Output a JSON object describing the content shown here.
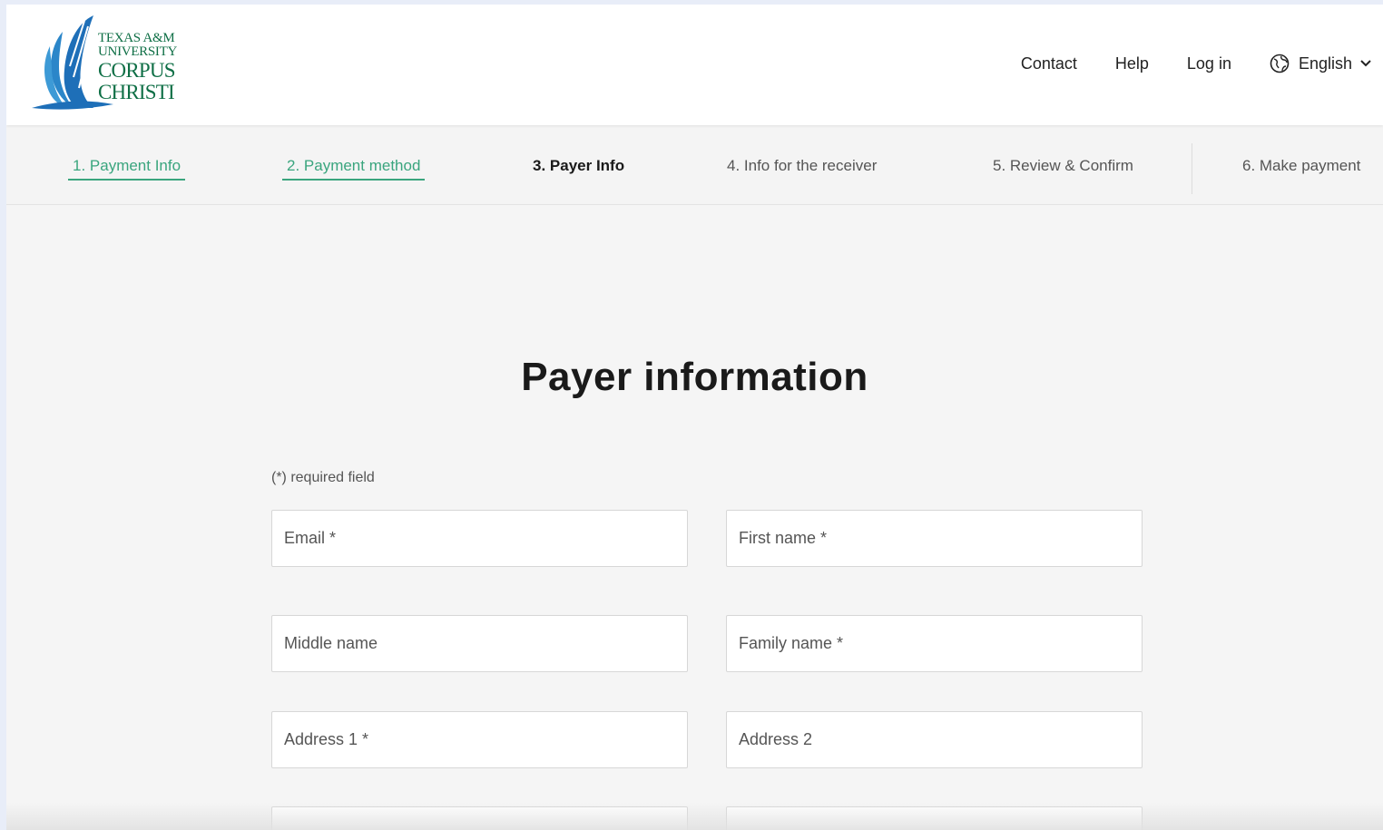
{
  "logo": {
    "line1": "TEXAS A&M",
    "line2": "UNIVERSITY",
    "line3": "CORPUS",
    "line4": "CHRISTI",
    "color": "#0f6f46",
    "icon": "wing-logo-icon"
  },
  "nav": {
    "contact": "Contact",
    "help": "Help",
    "login": "Log in",
    "language": "English",
    "language_icon": "globe-icon"
  },
  "steps": [
    {
      "label": "1. Payment Info",
      "state": "done"
    },
    {
      "label": "2. Payment method",
      "state": "done"
    },
    {
      "label": "3. Payer Info",
      "state": "active"
    },
    {
      "label": "4. Info for the receiver",
      "state": "pending"
    },
    {
      "label": "5. Review & Confirm",
      "state": "pending"
    },
    {
      "label": "6. Make payment",
      "state": "pending"
    }
  ],
  "form": {
    "title": "Payer information",
    "required_note": "(*) required field",
    "fields": {
      "email": "Email *",
      "first_name": "First name *",
      "middle_name": "Middle name",
      "family_name": "Family name *",
      "address1": "Address 1 *",
      "address2": "Address 2",
      "city": "",
      "state": ""
    }
  },
  "colors": {
    "accent_green": "#3aa57e",
    "logo_blue": "#1e6fb8",
    "background": "#f5f5f5"
  }
}
